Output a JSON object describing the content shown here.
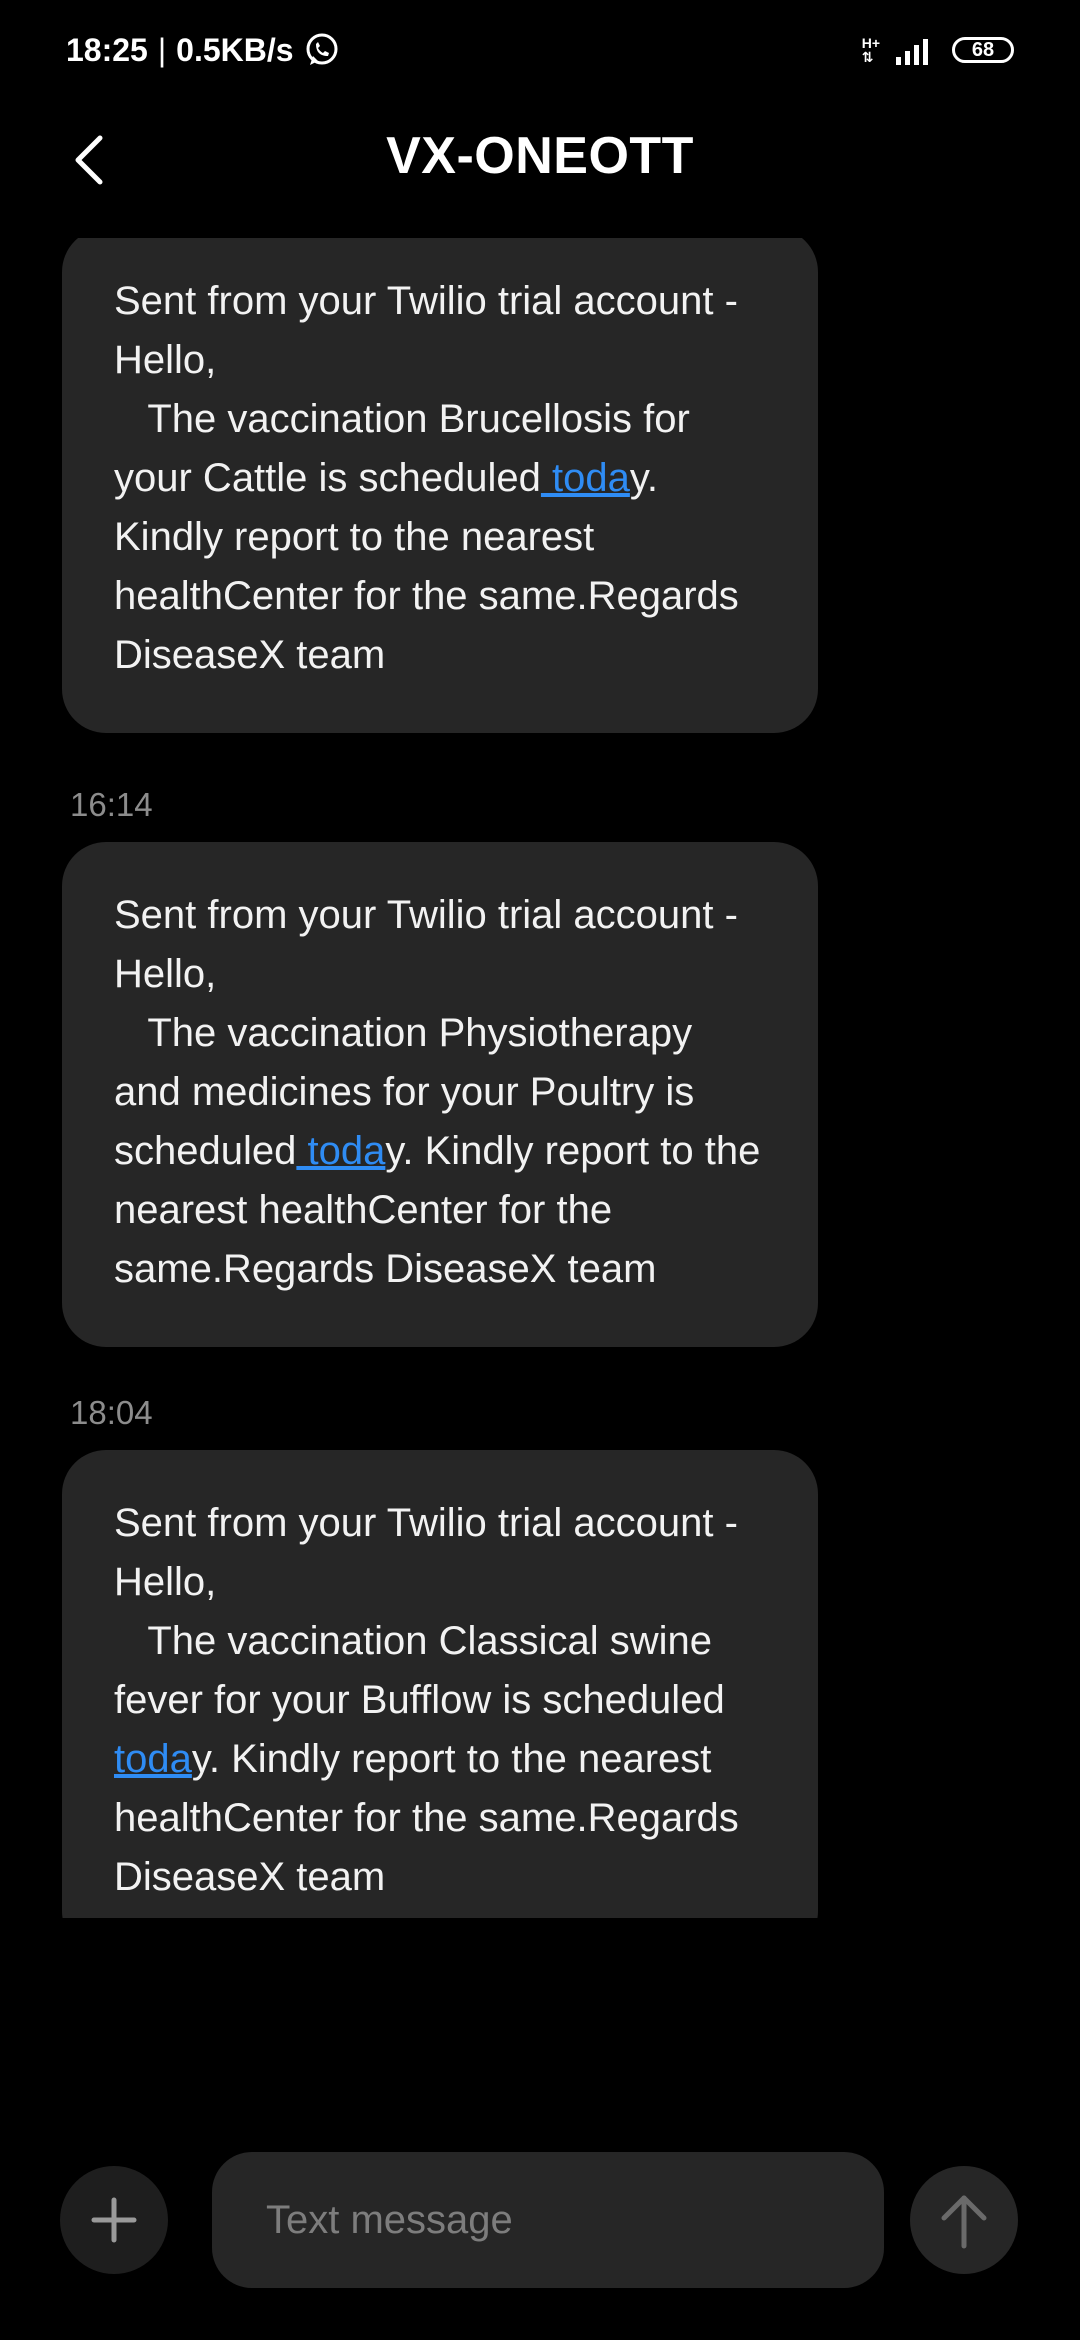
{
  "status_bar": {
    "time": "18:25",
    "separator": "|",
    "speed": "0.5KB/s",
    "network_top": "H+",
    "network_bottom": "⇅",
    "battery": "68"
  },
  "header": {
    "title": "VX-ONEOTT"
  },
  "messages": [
    {
      "timestamp": "",
      "text_before": "Sent from your Twilio trial account - Hello,\n   The vaccination Brucellosis for your Cattle is scheduled",
      "link": " toda",
      "text_after": "y. Kindly report to the nearest healthCenter for the same.Regards DiseaseX team"
    },
    {
      "timestamp": "16:14",
      "text_before": "Sent from your Twilio trial account - Hello,\n   The vaccination Physiotherapy and medicines for your Poultry is scheduled",
      "link": " toda",
      "text_after": "y. Kindly report to the nearest healthCenter for the same.Regards DiseaseX team"
    },
    {
      "timestamp": "18:04",
      "text_before": "Sent from your Twilio trial account - Hello,\n   The vaccination Classical swine fever for your Bufflow is scheduled ",
      "link": "toda",
      "text_after": "y. Kindly report to the nearest healthCenter for the same.Regards DiseaseX team"
    }
  ],
  "composer": {
    "placeholder": "Text message"
  },
  "colors": {
    "background": "#000000",
    "bubble": "#262626",
    "link": "#2f8cf4",
    "timestamp": "#8c8c8c"
  }
}
